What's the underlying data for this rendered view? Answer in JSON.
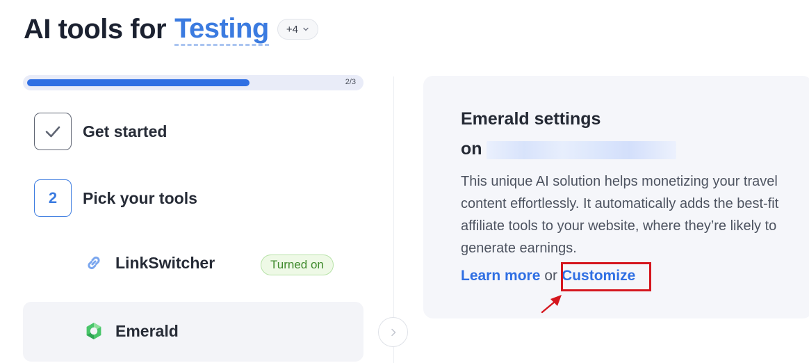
{
  "header": {
    "title_prefix": "AI tools for",
    "title_link": "Testing",
    "more_count": "+4"
  },
  "progress": {
    "label": "2/3",
    "fraction": 0.67
  },
  "steps": [
    {
      "label": "Get started",
      "state": "done"
    },
    {
      "number": "2",
      "label": "Pick your tools",
      "state": "active"
    }
  ],
  "tools": [
    {
      "name": "LinkSwitcher",
      "icon": "link-icon",
      "badge": "Turned on"
    },
    {
      "name": "Emerald",
      "icon": "emerald-logo-icon"
    }
  ],
  "panel": {
    "title": "Emerald settings",
    "on_label": "on",
    "description": "This unique AI solution helps monetizing your travel content effortlessly. It automatically adds the best-fit affiliate tools to your website, where they’re likely to generate earnings.",
    "learn_more": "Learn more",
    "or_text": "or",
    "customize": "Customize"
  },
  "colors": {
    "accent": "#2f6fe3",
    "badge_green": "#3f8a2c",
    "highlight_red": "#d5161e"
  }
}
